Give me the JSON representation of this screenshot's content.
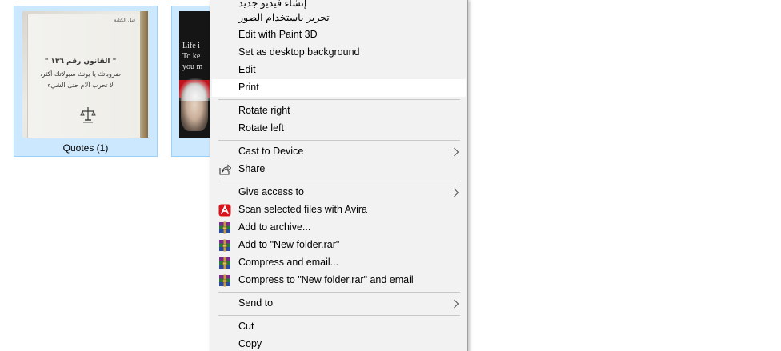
{
  "files": [
    {
      "name": "Quotes (1)",
      "thumbnail": {
        "corner_text": "قبل الكتابة",
        "lines": [
          "\" القانون رقم ١٣٦ \"",
          "ضروباتك يا يونك سيولاتك أكثر،",
          "لا تحرب آلام حتى الشيء"
        ]
      }
    },
    {
      "name": "",
      "thumbnail": {
        "lines": [
          "Life i",
          "To ke",
          "you m"
        ]
      }
    }
  ],
  "context_menu": {
    "items": [
      {
        "label": "إنشاء فيديو جديد",
        "icon": null,
        "submenu": false
      },
      {
        "label": "تحرير باستخدام الصور",
        "icon": null,
        "submenu": false
      },
      {
        "label": "Edit with Paint 3D",
        "icon": null,
        "submenu": false
      },
      {
        "label": "Set as desktop background",
        "icon": null,
        "submenu": false
      },
      {
        "label": "Edit",
        "icon": null,
        "submenu": false
      },
      {
        "label": "Print",
        "icon": null,
        "submenu": false,
        "highlighted": true
      },
      {
        "label": "Rotate right",
        "icon": null,
        "submenu": false
      },
      {
        "label": "Rotate left",
        "icon": null,
        "submenu": false
      },
      {
        "label": "Cast to Device",
        "icon": null,
        "submenu": true
      },
      {
        "label": "Share",
        "icon": "share-icon",
        "submenu": false
      },
      {
        "label": "Give access to",
        "icon": null,
        "submenu": true
      },
      {
        "label": "Scan selected files with Avira",
        "icon": "avira-icon",
        "submenu": false
      },
      {
        "label": "Add to archive...",
        "icon": "winrar-icon",
        "submenu": false
      },
      {
        "label": "Add to \"New folder.rar\"",
        "icon": "winrar-icon",
        "submenu": false
      },
      {
        "label": "Compress and email...",
        "icon": "winrar-icon",
        "submenu": false
      },
      {
        "label": "Compress to \"New folder.rar\" and email",
        "icon": "winrar-icon",
        "submenu": false
      },
      {
        "label": "Send to",
        "icon": null,
        "submenu": true
      },
      {
        "label": "Cut",
        "icon": null,
        "submenu": false
      },
      {
        "label": "Copy",
        "icon": null,
        "submenu": false
      }
    ]
  },
  "colors": {
    "selection_fill": "#cce8ff",
    "selection_border": "#99d1ff",
    "menu_background": "#f2f2f2",
    "menu_hover": "#ffffff",
    "avira_red": "#d8141a"
  }
}
